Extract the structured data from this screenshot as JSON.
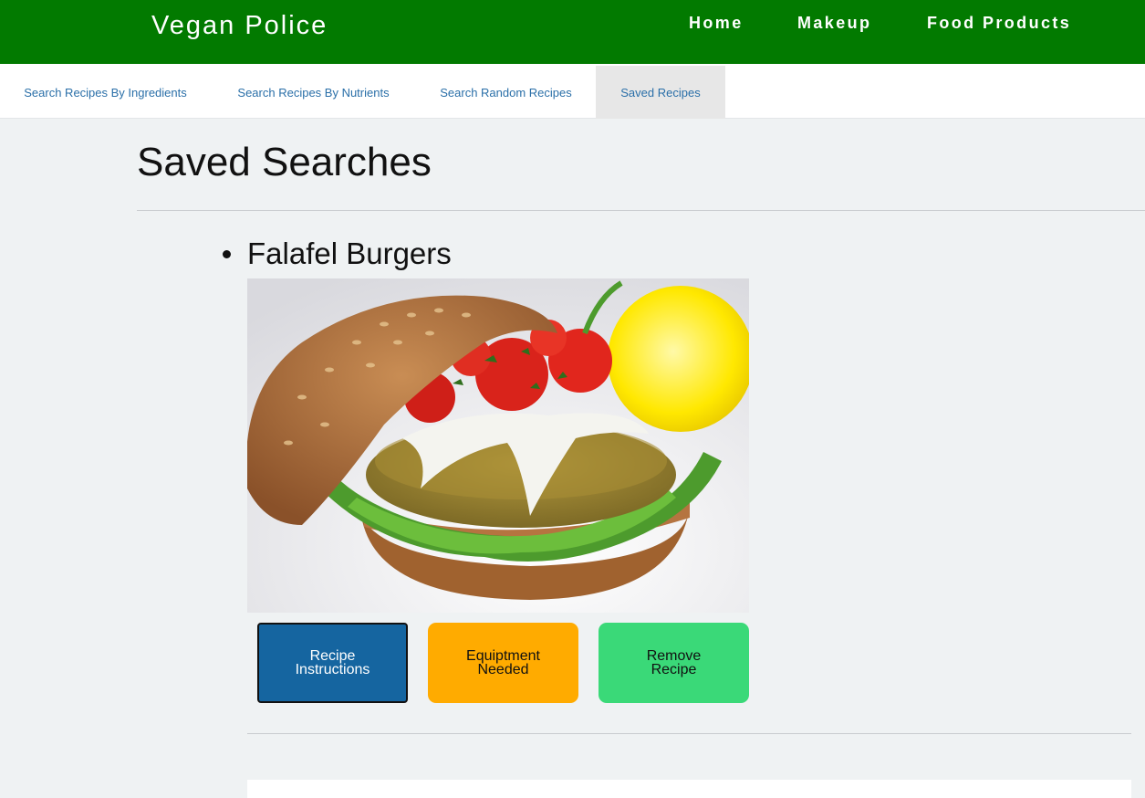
{
  "header": {
    "brand": "Vegan Police",
    "nav": [
      {
        "label": "Home"
      },
      {
        "label": "Makeup"
      },
      {
        "label": "Food Products"
      }
    ]
  },
  "subnav": {
    "tabs": [
      {
        "label": "Search Recipes By Ingredients",
        "active": false
      },
      {
        "label": "Search Recipes By Nutrients",
        "active": false
      },
      {
        "label": "Search Random Recipes",
        "active": false
      },
      {
        "label": "Saved Recipes",
        "active": true
      }
    ]
  },
  "main": {
    "title": "Saved Searches",
    "recipes": [
      {
        "name": "Falafel Burgers",
        "image": "falafel-burger-photo",
        "buttons": {
          "instructions": "Recipe Instructions",
          "equipment": "Equiptment Needed",
          "remove": "Remove Recipe"
        }
      }
    ]
  },
  "colors": {
    "header_bg": "#027a00",
    "page_bg": "#eff2f3",
    "tab_text": "#2a6fa8",
    "instructions_button": "#1565a0",
    "equipment_button": "#ffab00",
    "remove_button": "#3ad978"
  }
}
